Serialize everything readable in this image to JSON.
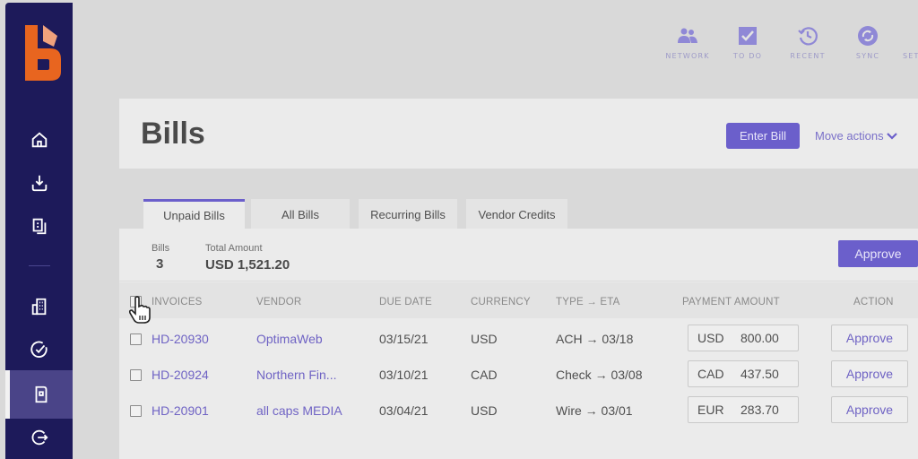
{
  "sidebar": {
    "logo": "bill-logo",
    "items": [
      {
        "name": "home",
        "icon": "home-icon"
      },
      {
        "name": "inbox",
        "icon": "download-icon"
      },
      {
        "name": "documents",
        "icon": "documents-icon"
      },
      {
        "name": "vendors",
        "icon": "building-icon"
      },
      {
        "name": "approvals",
        "icon": "check-circle-icon"
      },
      {
        "name": "bills",
        "icon": "bill-icon",
        "active": true
      },
      {
        "name": "logout",
        "icon": "logout-icon"
      }
    ]
  },
  "toolbar": {
    "items": [
      {
        "label": "NETWORK",
        "icon": "people-icon"
      },
      {
        "label": "TO DO",
        "icon": "checkbox-icon"
      },
      {
        "label": "RECENT",
        "icon": "history-icon"
      },
      {
        "label": "SYNC",
        "icon": "sync-icon"
      },
      {
        "label": "SET",
        "icon": "settings-icon"
      }
    ]
  },
  "header": {
    "title": "Bills",
    "enter_bill": "Enter Bill",
    "move_actions": "Move actions"
  },
  "tabs": [
    {
      "label": "Unpaid Bills",
      "active": true
    },
    {
      "label": "All Bills"
    },
    {
      "label": "Recurring Bills"
    },
    {
      "label": "Vendor Credits"
    }
  ],
  "summary": {
    "bills_label": "Bills",
    "bills_count": "3",
    "total_label": "Total Amount",
    "total_value": "USD 1,521.20",
    "approve_label": "Approve"
  },
  "table": {
    "columns": [
      "INVOICES",
      "VENDOR",
      "DUE DATE",
      "CURRENCY",
      "TYPE → ETA",
      "PAYMENT AMOUNT",
      "ACTION"
    ],
    "rows": [
      {
        "invoice": "HD-20930",
        "vendor": "OptimaWeb",
        "due_date": "03/15/21",
        "currency": "USD",
        "type_eta": "ACH → 03/18",
        "pay_currency": "USD",
        "pay_amount": "800.00",
        "action": "Approve"
      },
      {
        "invoice": "HD-20924",
        "vendor": "Northern Fin...",
        "due_date": "03/10/21",
        "currency": "CAD",
        "type_eta": "Check → 03/08",
        "pay_currency": "CAD",
        "pay_amount": "437.50",
        "action": "Approve"
      },
      {
        "invoice": "HD-20901",
        "vendor": "all caps MEDIA",
        "due_date": "03/04/21",
        "currency": "USD",
        "type_eta": "Wire → 03/01",
        "pay_currency": "EUR",
        "pay_amount": "283.70",
        "action": "Approve"
      }
    ]
  },
  "colors": {
    "sidebar": "#1d1a5a",
    "accent": "#6b5fcb",
    "logo": "#e8651f"
  }
}
